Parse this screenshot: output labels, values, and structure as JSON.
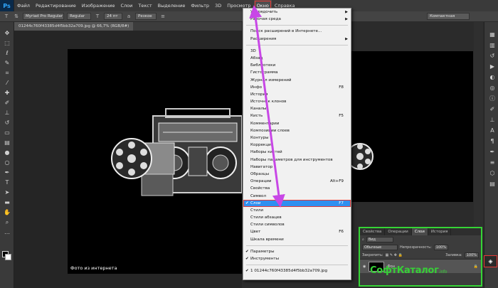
{
  "app": {
    "logo": "Ps"
  },
  "menubar": {
    "items": [
      "Файл",
      "Редактирование",
      "Изображение",
      "Слои",
      "Текст",
      "Выделение",
      "Фильтр",
      "3D",
      "Просмотр",
      "Окно",
      "Справка"
    ],
    "active": "Окно"
  },
  "options_bar": {
    "font_family": "Myriad Pro Regular",
    "font_style": "Regular",
    "font_size": "24 пт",
    "antialias": "Резкое",
    "workspace": "Компактная"
  },
  "document": {
    "tab_title": "01244c760f43385d4f5bb32a709.jpg @ 66,7% (RGB/8#)",
    "caption": "Фото из интернета"
  },
  "window_menu": {
    "items": [
      {
        "label": "Упорядочить",
        "submenu": true
      },
      {
        "label": "Рабочая среда",
        "submenu": true
      },
      {
        "sep": true
      },
      {
        "label": "Поиск расширений в Интернете..."
      },
      {
        "label": "Расширения",
        "submenu": true
      },
      {
        "sep": true
      },
      {
        "label": "3D"
      },
      {
        "label": "Абзац"
      },
      {
        "label": "Библиотеки"
      },
      {
        "label": "Гистограмма"
      },
      {
        "label": "Журнал измерений"
      },
      {
        "label": "Инфо",
        "key": "F8"
      },
      {
        "label": "История"
      },
      {
        "label": "Источник клонов"
      },
      {
        "label": "Каналы"
      },
      {
        "label": "Кисть",
        "key": "F5"
      },
      {
        "label": "Комментарии"
      },
      {
        "label": "Композиции слоев"
      },
      {
        "label": "Контуры"
      },
      {
        "label": "Коррекция"
      },
      {
        "label": "Наборы кистей"
      },
      {
        "label": "Наборы параметров для инструментов"
      },
      {
        "label": "Навигатор"
      },
      {
        "label": "Образцы"
      },
      {
        "label": "Операции",
        "key": "Alt+F9"
      },
      {
        "label": "Свойства"
      },
      {
        "label": "Символ"
      },
      {
        "label": "Слои",
        "key": "F7",
        "checked": true,
        "selected": true
      },
      {
        "label": "Стили"
      },
      {
        "label": "Стили абзацев"
      },
      {
        "label": "Стили символов"
      },
      {
        "label": "Цвет",
        "key": "F6"
      },
      {
        "label": "Шкала времени"
      },
      {
        "sep": true
      },
      {
        "label": "Параметры",
        "checked": true
      },
      {
        "label": "Инструменты",
        "checked": true
      },
      {
        "sep": true
      },
      {
        "label": "1 01244c760f43385d4f5bb32a709.jpg",
        "checked": true
      }
    ]
  },
  "layers_panel": {
    "tabs": [
      "Свойства",
      "Операции",
      "Слои",
      "История"
    ],
    "active_tab": "Слои",
    "kind_filter": "Вид",
    "blend_mode": "Обычные",
    "opacity_label": "Непрозрачность:",
    "opacity_value": "100%",
    "lock_label": "Закрепить:",
    "fill_label": "Заливка:",
    "fill_value": "100%",
    "layer_name": "Фон"
  },
  "watermark": {
    "text": "СофтКаталог",
    "suffix": ".info"
  },
  "colors": {
    "highlight_red": "#e53935",
    "annotation_arrow": "#c847e6",
    "annotation_box": "#35d435",
    "menu_selection": "#2f8ff0"
  }
}
